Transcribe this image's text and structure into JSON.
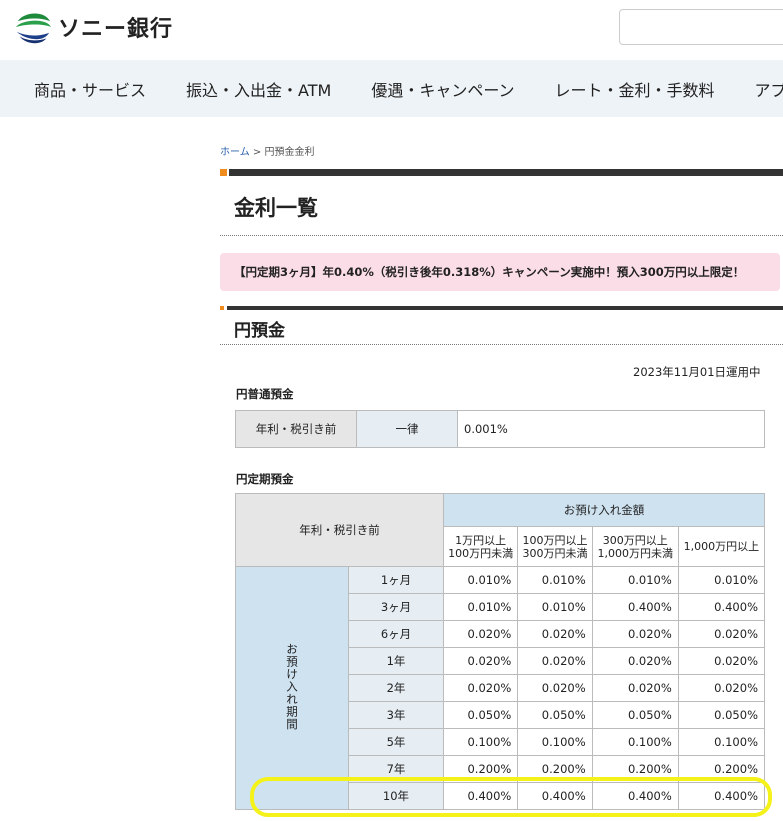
{
  "header": {
    "logo_text": "ソニー銀行",
    "search_placeholder": ""
  },
  "nav": {
    "items": [
      "商品・サービス",
      "振込・入出金・ATM",
      "優遇・キャンペーン",
      "レート・金利・手数料",
      "アプ"
    ]
  },
  "breadcrumb": {
    "home": "ホーム",
    "separator": ">",
    "current": "円預金金利"
  },
  "page_title": "金利一覧",
  "campaign_banner": "【円定期3ヶ月】年0.40%（税引き後年0.318%）キャンペーン実施中！預入300万円以上限定！",
  "section_title": "円預金",
  "date_note": "2023年11月01日運用中",
  "ordinary": {
    "label": "円普通預金",
    "header": "年利・税引き前",
    "type": "一律",
    "rate": "0.001%"
  },
  "time_deposit": {
    "label": "円定期預金",
    "corner": "年利・税引き前",
    "amount_header": "お預け入れ金額",
    "amount_columns": [
      {
        "line1": "1万円以上",
        "line2": "100万円未満"
      },
      {
        "line1": "100万円以上",
        "line2": "300万円未満"
      },
      {
        "line1": "300万円以上",
        "line2": "1,000万円未満"
      },
      {
        "line1": "1,000万円以上",
        "line2": ""
      }
    ],
    "period_header": "お預け入れ期間",
    "rows": [
      {
        "term": "1ヶ月",
        "rates": [
          "0.010%",
          "0.010%",
          "0.010%",
          "0.010%"
        ]
      },
      {
        "term": "3ヶ月",
        "rates": [
          "0.010%",
          "0.010%",
          "0.400%",
          "0.400%"
        ]
      },
      {
        "term": "6ヶ月",
        "rates": [
          "0.020%",
          "0.020%",
          "0.020%",
          "0.020%"
        ]
      },
      {
        "term": "1年",
        "rates": [
          "0.020%",
          "0.020%",
          "0.020%",
          "0.020%"
        ]
      },
      {
        "term": "2年",
        "rates": [
          "0.020%",
          "0.020%",
          "0.020%",
          "0.020%"
        ]
      },
      {
        "term": "3年",
        "rates": [
          "0.050%",
          "0.050%",
          "0.050%",
          "0.050%"
        ]
      },
      {
        "term": "5年",
        "rates": [
          "0.100%",
          "0.100%",
          "0.100%",
          "0.100%"
        ]
      },
      {
        "term": "7年",
        "rates": [
          "0.200%",
          "0.200%",
          "0.200%",
          "0.200%"
        ]
      },
      {
        "term": "10年",
        "rates": [
          "0.400%",
          "0.400%",
          "0.400%",
          "0.400%"
        ]
      }
    ]
  },
  "colors": {
    "accent_orange": "#f08c1e",
    "campaign_bg": "#fbdde8",
    "table_header_blue": "#cfe2f0",
    "highlight_yellow": "#f4f218"
  }
}
